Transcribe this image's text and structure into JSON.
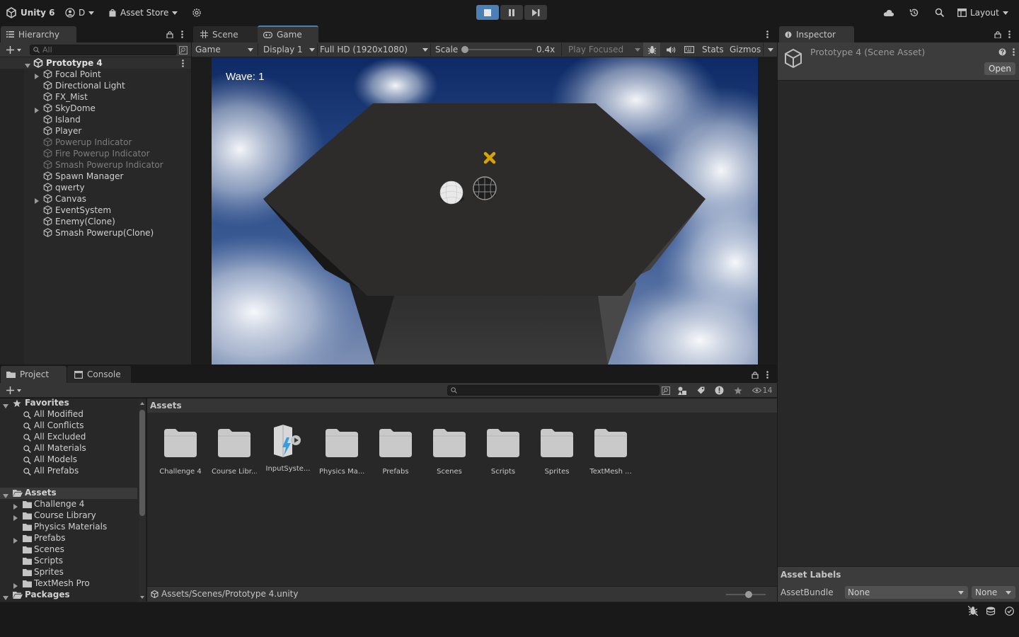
{
  "topbar": {
    "app_name": "Unity 6",
    "account_label": "D",
    "asset_store_label": "Asset Store",
    "layout_label": "Layout"
  },
  "hierarchy": {
    "tab_label": "Hierarchy",
    "search_placeholder": "All",
    "scene_name": "Prototype 4",
    "items": [
      {
        "label": "Focal Point",
        "foldable": true,
        "dim": false
      },
      {
        "label": "Directional Light",
        "foldable": false,
        "dim": false
      },
      {
        "label": "FX_Mist",
        "foldable": false,
        "dim": false
      },
      {
        "label": "SkyDome",
        "foldable": true,
        "dim": false
      },
      {
        "label": "Island",
        "foldable": false,
        "dim": false
      },
      {
        "label": "Player",
        "foldable": false,
        "dim": false
      },
      {
        "label": "Powerup Indicator",
        "foldable": false,
        "dim": true
      },
      {
        "label": "Fire Powerup Indicator",
        "foldable": false,
        "dim": true
      },
      {
        "label": "Smash Powerup Indicator",
        "foldable": false,
        "dim": true
      },
      {
        "label": "Spawn Manager",
        "foldable": false,
        "dim": false
      },
      {
        "label": "qwerty",
        "foldable": false,
        "dim": false
      },
      {
        "label": "Canvas",
        "foldable": true,
        "dim": false
      },
      {
        "label": "EventSystem",
        "foldable": false,
        "dim": false
      },
      {
        "label": "Enemy(Clone)",
        "foldable": false,
        "dim": false
      },
      {
        "label": "Smash Powerup(Clone)",
        "foldable": false,
        "dim": false
      }
    ]
  },
  "game": {
    "scene_tab": "Scene",
    "game_tab": "Game",
    "view_mode": "Game",
    "display": "Display 1",
    "resolution": "Full HD (1920x1080)",
    "scale_label": "Scale",
    "scale_value": "0.4x",
    "play_mode": "Play Focused",
    "stats_label": "Stats",
    "gizmos_label": "Gizmos",
    "wave_text": "Wave: 1"
  },
  "inspector": {
    "tab_label": "Inspector",
    "title": "Prototype 4 (Scene Asset)",
    "open_button": "Open",
    "asset_labels": "Asset Labels",
    "assetbundle_label": "AssetBundle",
    "assetbundle_value": "None",
    "variant_value": "None"
  },
  "project": {
    "project_tab": "Project",
    "console_tab": "Console",
    "hidden_count": "14",
    "favorites_label": "Favorites",
    "favorites": [
      "All Modified",
      "All Conflicts",
      "All Excluded",
      "All Materials",
      "All Models",
      "All Prefabs"
    ],
    "assets_label": "Assets",
    "asset_folders": [
      {
        "label": "Challenge 4",
        "foldable": true
      },
      {
        "label": "Course Library",
        "foldable": true
      },
      {
        "label": "Physics Materials",
        "foldable": false
      },
      {
        "label": "Prefabs",
        "foldable": true
      },
      {
        "label": "Scenes",
        "foldable": false
      },
      {
        "label": "Scripts",
        "foldable": false
      },
      {
        "label": "Sprites",
        "foldable": false
      },
      {
        "label": "TextMesh Pro",
        "foldable": true
      }
    ],
    "packages_label": "Packages",
    "breadcrumb": "Assets",
    "grid_items": [
      "Challenge 4",
      "Course Libr...",
      "InputSyste...",
      "Physics Ma...",
      "Prefabs",
      "Scenes",
      "Scripts",
      "Sprites",
      "TextMesh ..."
    ],
    "footer_path": "Assets/Scenes/Prototype 4.unity"
  },
  "colors": {
    "accent": "#4c7fb4",
    "panel": "#282828",
    "background": "#191919"
  }
}
